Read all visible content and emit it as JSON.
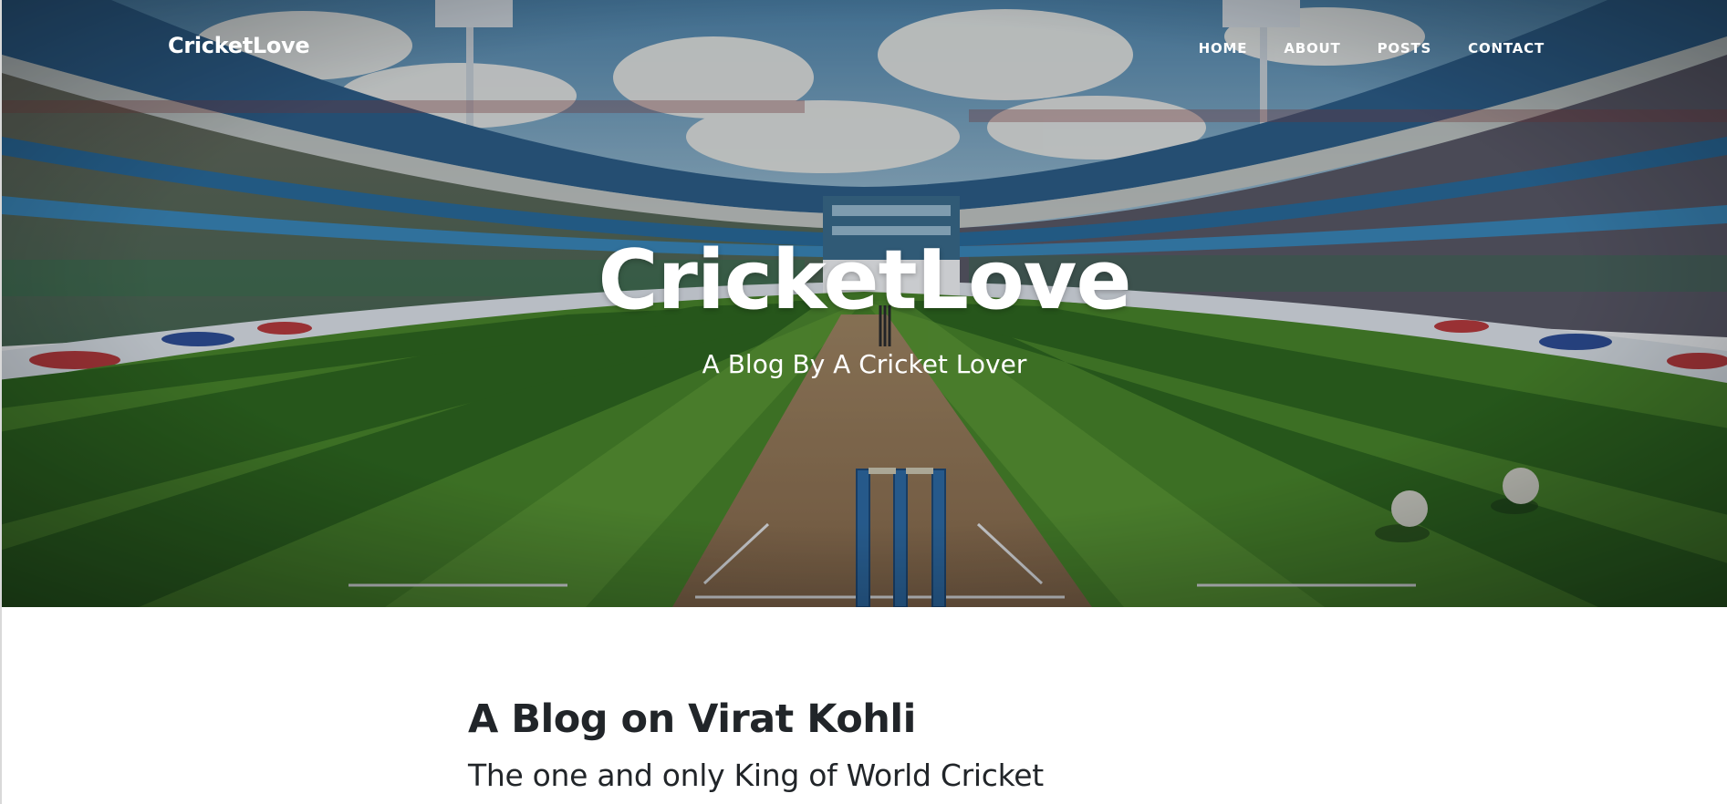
{
  "navbar": {
    "brand": "CricketLove",
    "items": [
      {
        "label": "HOME"
      },
      {
        "label": "ABOUT"
      },
      {
        "label": "POSTS"
      },
      {
        "label": "CONTACT"
      }
    ]
  },
  "hero": {
    "heading": "CricketLove",
    "subheading": "A Blog By A Cricket Lover",
    "background": "cricket-stadium-image"
  },
  "post": {
    "title": "A Blog on Virat Kohli",
    "subtitle": "The one and only King of World Cricket"
  },
  "colors": {
    "text_dark": "#212529",
    "text_light": "#ffffff",
    "grass_light": "#5a9a2c",
    "grass_dark": "#2f6a1a",
    "sky": "#6fa6c8"
  }
}
